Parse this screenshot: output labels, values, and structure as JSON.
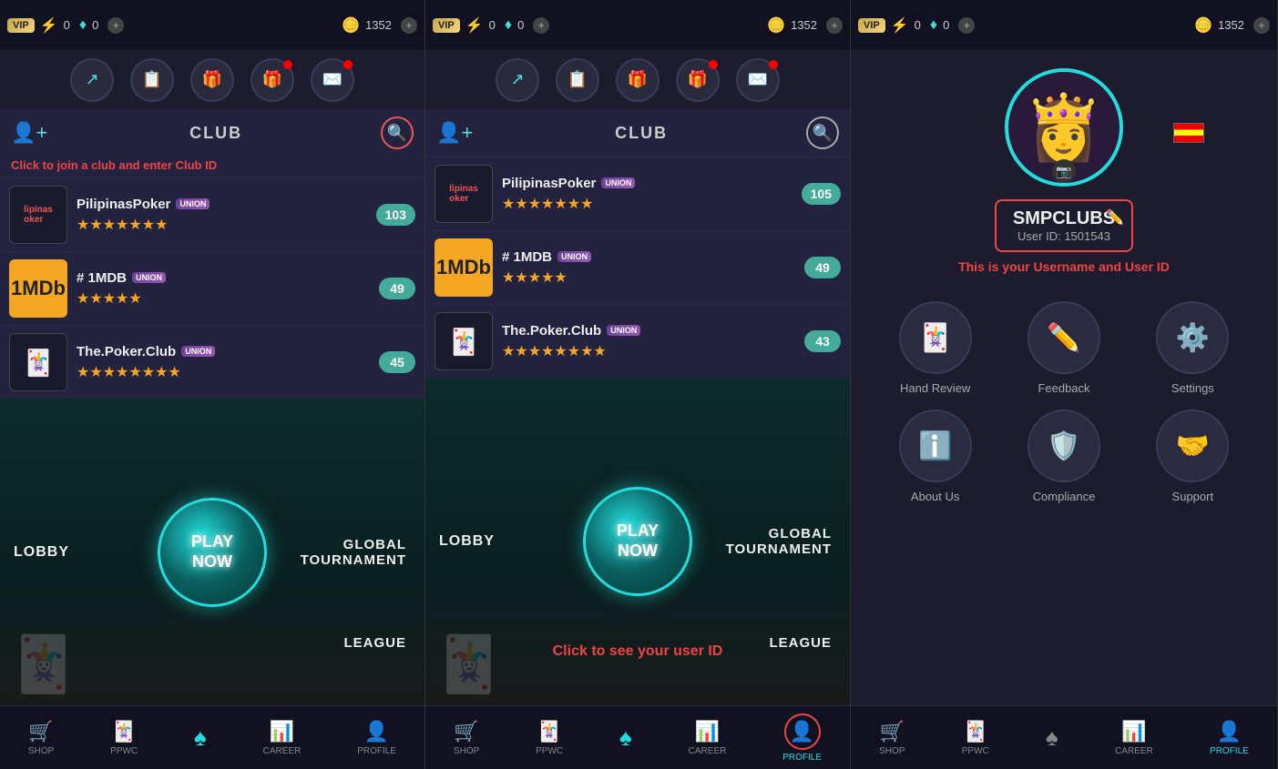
{
  "panels": [
    {
      "id": "panel1",
      "topbar": {
        "vip_label": "VIP",
        "lightning_count": "0",
        "gem_count": "0",
        "coin_count": "1352"
      },
      "club_header": "CLUB",
      "club_hint": "Click to join a club and enter Club ID",
      "clubs": [
        {
          "name": "PilipinasPoker",
          "stars": 7,
          "count": "103"
        },
        {
          "name": "# 1MDB",
          "stars": 5,
          "count": "49"
        },
        {
          "name": "The.Poker.Club",
          "stars": 8,
          "count": "45"
        }
      ],
      "play": {
        "lobby": "LOBBY",
        "global_tournament": "GLOBAL\nTOURNAMENT",
        "play_now": "PLAY\nNOW",
        "league": "LEAGUE"
      },
      "nav": [
        {
          "label": "SHOP",
          "icon": "🛒",
          "active": false
        },
        {
          "label": "PPWC",
          "icon": "🃏",
          "active": false
        },
        {
          "label": "",
          "icon": "♠",
          "active": true,
          "is_spade": true
        },
        {
          "label": "CAREER",
          "icon": "📊",
          "active": false
        },
        {
          "label": "PROFILE",
          "icon": "👤",
          "active": false
        }
      ]
    },
    {
      "id": "panel2",
      "topbar": {
        "vip_label": "VIP",
        "lightning_count": "0",
        "gem_count": "0",
        "coin_count": "1352"
      },
      "club_header": "CLUB",
      "clubs": [
        {
          "name": "PilipinasPoker",
          "stars": 7,
          "count": "105"
        },
        {
          "name": "# 1MDB",
          "stars": 5,
          "count": "49"
        },
        {
          "name": "The.Poker.Club",
          "stars": 8,
          "count": "43"
        }
      ],
      "play": {
        "lobby": "LOBBY",
        "global_tournament": "GLOBAL\nTOURNAMENT",
        "play_now": "PLAY\nNOW",
        "league": "LEAGUE"
      },
      "click_hint": "Click to see your user ID",
      "nav": [
        {
          "label": "SHOP",
          "icon": "🛒",
          "active": false
        },
        {
          "label": "PPWC",
          "icon": "🃏",
          "active": false
        },
        {
          "label": "",
          "icon": "♠",
          "active": true,
          "is_spade": true
        },
        {
          "label": "CAREER",
          "icon": "📊",
          "active": false
        },
        {
          "label": "PROFILE",
          "icon": "👤",
          "active": true,
          "highlight": true
        }
      ]
    },
    {
      "id": "panel3",
      "topbar": {
        "vip_label": "VIP",
        "lightning_count": "0",
        "gem_count": "0",
        "coin_count": "1352"
      },
      "username": "SMPCLUBS",
      "userid": "User ID: 1501543",
      "username_hint": "This is your Username and User ID",
      "menu_items": [
        {
          "label": "Hand Review",
          "icon": "🃏"
        },
        {
          "label": "Feedback",
          "icon": "✏️"
        },
        {
          "label": "Settings",
          "icon": "⚙️"
        },
        {
          "label": "About Us",
          "icon": "ℹ️"
        },
        {
          "label": "Compliance",
          "icon": "🛡️"
        },
        {
          "label": "Support",
          "icon": "🤝"
        }
      ],
      "nav": [
        {
          "label": "SHOP",
          "icon": "🛒",
          "active": false
        },
        {
          "label": "PPWC",
          "icon": "🃏",
          "active": false
        },
        {
          "label": "",
          "icon": "♠",
          "active": false,
          "is_spade": true
        },
        {
          "label": "CAREER",
          "icon": "📊",
          "active": false
        },
        {
          "label": "PROFILE",
          "icon": "👤",
          "active": true
        }
      ]
    }
  ]
}
